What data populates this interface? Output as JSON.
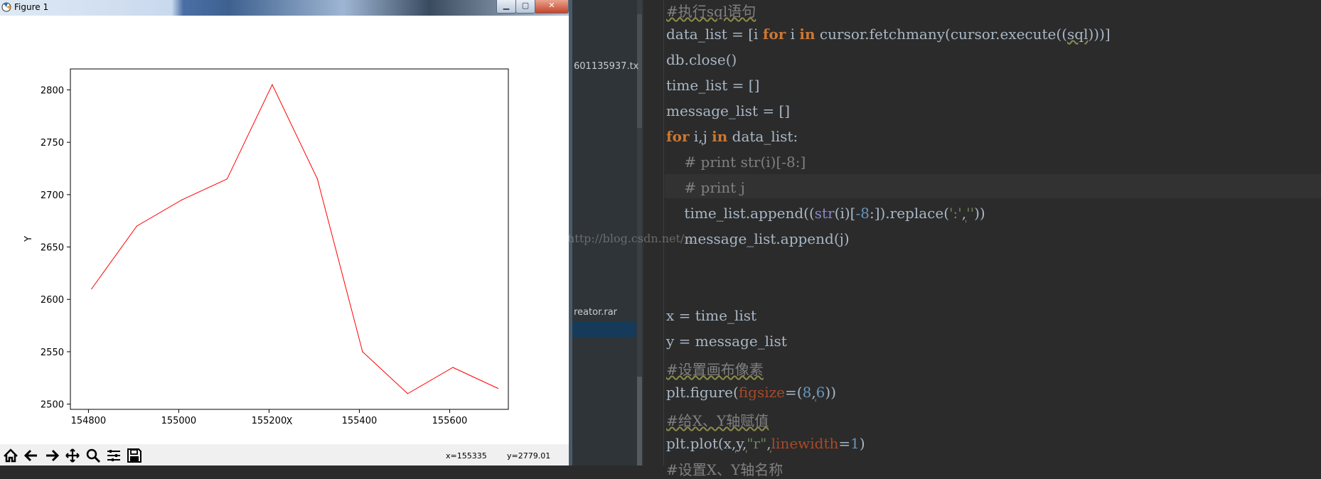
{
  "window": {
    "title": "Figure 1"
  },
  "chart_data": {
    "type": "line",
    "title": "",
    "xlabel": "X",
    "ylabel": "Y",
    "xlim": [
      154760,
      155730
    ],
    "ylim": [
      2495,
      2820
    ],
    "x_ticks": [
      154800,
      155000,
      155200,
      155400,
      155600
    ],
    "y_ticks": [
      2500,
      2550,
      2600,
      2650,
      2700,
      2750,
      2800
    ],
    "x_tick_labels": [
      "154800",
      "155000",
      "155200",
      "155400",
      "155600"
    ],
    "y_tick_labels": [
      "2500",
      "2550",
      "2600",
      "2650",
      "2700",
      "2750",
      "2800"
    ],
    "series": [
      {
        "color": "#ff0000",
        "linewidth": 1,
        "x": [
          154807,
          154907,
          155007,
          155107,
          155207,
          155307,
          155407,
          155507,
          155607,
          155707
        ],
        "y": [
          2610,
          2670,
          2695,
          2715,
          2805,
          2715,
          2550,
          2510,
          2535,
          2515
        ]
      }
    ],
    "grid": false,
    "legend": "none"
  },
  "toolbar": {
    "buttons": [
      {
        "name": "home-icon"
      },
      {
        "name": "back-arrow-icon"
      },
      {
        "name": "forward-arrow-icon"
      },
      {
        "name": "pan-icon"
      },
      {
        "name": "zoom-icon"
      },
      {
        "name": "subplots-icon"
      },
      {
        "name": "save-icon"
      }
    ],
    "x_readout": "x=155335",
    "y_readout": "y=2779.01"
  },
  "explorer": {
    "file1": "601135937.tx",
    "file2": "reator.rar"
  },
  "editor": {
    "watermark": "http://blog.csdn.net/...",
    "lines": [
      "#执行sql语句",
      "data_list = [i for i in cursor.fetchmany(cursor.execute((sql)))]",
      "db.close()",
      "time_list = []",
      "message_list = []",
      "for i,j in data_list:",
      "    # print str(i)[-8:]",
      "    # print j",
      "    time_list.append((str(i)[-8:]).replace(':',''))",
      "    message_list.append(j)",
      "",
      "",
      "x = time_list",
      "y = message_list",
      "#设置画布像素",
      "plt.figure(figsize=(8,6))",
      "#给X、Y轴赋值",
      "plt.plot(x,y,\"r\",linewidth=1)",
      "#设置X、Y轴名称"
    ]
  }
}
